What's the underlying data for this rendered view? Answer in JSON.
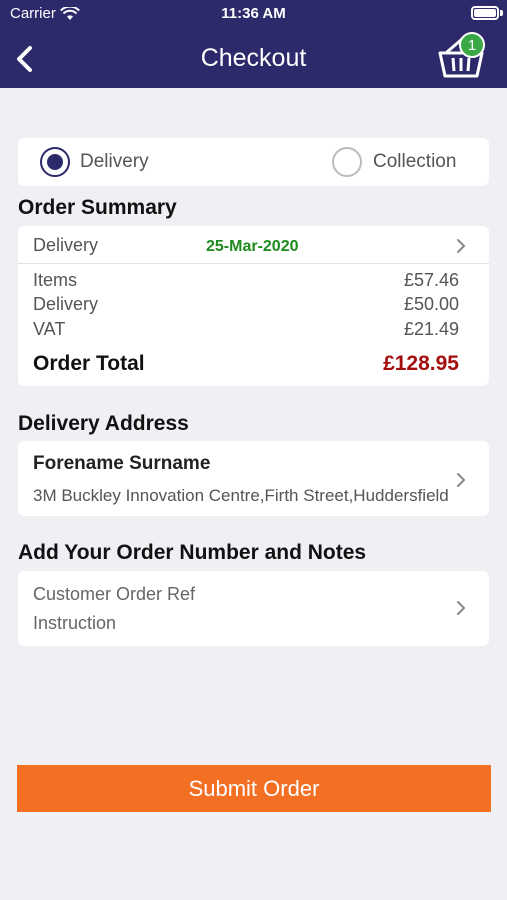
{
  "status_bar": {
    "carrier": "Carrier",
    "time": "11:36 AM"
  },
  "nav": {
    "title": "Checkout",
    "cart_count": "1"
  },
  "fulfilment": {
    "options": [
      {
        "label": "Delivery",
        "selected": true
      },
      {
        "label": "Collection",
        "selected": false
      }
    ]
  },
  "order_summary": {
    "heading": "Order Summary",
    "delivery_label": "Delivery",
    "delivery_date": "25-Mar-2020",
    "lines": [
      {
        "label": "Items",
        "value": "£57.46"
      },
      {
        "label": "Delivery",
        "value": "£50.00"
      },
      {
        "label": "VAT",
        "value": "£21.49"
      }
    ],
    "total_label": "Order Total",
    "total_value": "£128.95"
  },
  "delivery_address": {
    "heading": "Delivery Address",
    "name": "Forename Surname",
    "address": "3M Buckley Innovation Centre,Firth Street,Huddersfield"
  },
  "order_notes": {
    "heading": "Add Your Order Number and Notes",
    "order_ref_placeholder": "Customer Order Ref",
    "instruction_placeholder": "Instruction"
  },
  "submit_label": "Submit Order",
  "colors": {
    "nav": "#2c2a6b",
    "accent": "#f26f23",
    "date": "#1e8a1e",
    "total": "#a30f0f",
    "badge": "#3aa845"
  }
}
